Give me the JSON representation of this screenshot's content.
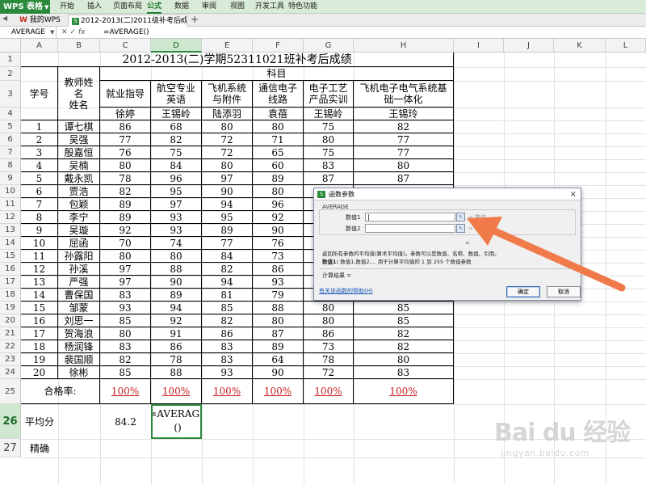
{
  "app": {
    "name": "WPS 表格"
  },
  "menu": {
    "items": [
      "开始",
      "插入",
      "页面布局",
      "公式",
      "数据",
      "审阅",
      "视图",
      "开发工具",
      "特色功能"
    ],
    "active": "公式"
  },
  "tabs": {
    "home": "我的WPS",
    "file": "2012-2013(二)2011级补考后成绩.xls *"
  },
  "formula_bar": {
    "name_box": "AVERAGE",
    "fx": "fx",
    "content": "=AVERAGE()"
  },
  "columns": [
    "A",
    "B",
    "C",
    "D",
    "E",
    "F",
    "G",
    "H",
    "I",
    "J",
    "K",
    "L"
  ],
  "active_column": "D",
  "active_row": "26",
  "sheet": {
    "title": "2012-2013(二)学期52311021班补考后成绩",
    "subject_header": "科目",
    "col_student_no": "学号",
    "col_teacher_name_1": "教师姓",
    "col_teacher_name_2": "名",
    "col_teacher_name_3": "姓名",
    "subjects": [
      {
        "l1": "就业指导",
        "l2": "",
        "teacher": "徐婷"
      },
      {
        "l1": "航空专业",
        "l2": "英语",
        "teacher": "王锡岭"
      },
      {
        "l1": "飞机系统",
        "l2": "与附件",
        "teacher": "陆添羽"
      },
      {
        "l1": "通信电子",
        "l2": "线路",
        "teacher": "袁蓓"
      },
      {
        "l1": "电子工艺",
        "l2": "产品实训",
        "teacher": "王锡岭"
      },
      {
        "l1": "飞机电子电气系统基",
        "l2": "础一体化",
        "teacher": "王锡玲"
      }
    ],
    "rows": [
      {
        "no": "1",
        "name": "谭七棋",
        "scores": [
          "86",
          "68",
          "80",
          "80",
          "75",
          "82"
        ]
      },
      {
        "no": "2",
        "name": "吴强",
        "scores": [
          "77",
          "82",
          "72",
          "71",
          "80",
          "77"
        ]
      },
      {
        "no": "3",
        "name": "殷嘉恒",
        "scores": [
          "76",
          "75",
          "72",
          "65",
          "75",
          "77"
        ]
      },
      {
        "no": "4",
        "name": "吴楠",
        "scores": [
          "80",
          "84",
          "80",
          "60",
          "83",
          "80"
        ]
      },
      {
        "no": "5",
        "name": "戴永凯",
        "scores": [
          "78",
          "96",
          "97",
          "89",
          "87",
          "87"
        ]
      },
      {
        "no": "6",
        "name": "贾浩",
        "scores": [
          "82",
          "95",
          "90",
          "80",
          "",
          ""
        ]
      },
      {
        "no": "7",
        "name": "包颖",
        "scores": [
          "89",
          "97",
          "94",
          "96",
          "",
          ""
        ]
      },
      {
        "no": "8",
        "name": "李宁",
        "scores": [
          "89",
          "93",
          "95",
          "92",
          "",
          ""
        ]
      },
      {
        "no": "9",
        "name": "吴璇",
        "scores": [
          "92",
          "93",
          "89",
          "90",
          "",
          ""
        ]
      },
      {
        "no": "10",
        "name": "屈函",
        "scores": [
          "70",
          "74",
          "77",
          "76",
          "",
          ""
        ]
      },
      {
        "no": "11",
        "name": "孙露阳",
        "scores": [
          "80",
          "80",
          "84",
          "73",
          "",
          ""
        ]
      },
      {
        "no": "12",
        "name": "孙溪",
        "scores": [
          "97",
          "88",
          "82",
          "86",
          "",
          ""
        ]
      },
      {
        "no": "13",
        "name": "严强",
        "scores": [
          "97",
          "90",
          "94",
          "93",
          "",
          ""
        ]
      },
      {
        "no": "14",
        "name": "曹保国",
        "scores": [
          "83",
          "89",
          "81",
          "79",
          "85",
          "83"
        ]
      },
      {
        "no": "15",
        "name": "邹蒙",
        "scores": [
          "93",
          "94",
          "85",
          "88",
          "80",
          "85"
        ]
      },
      {
        "no": "16",
        "name": "刘思一",
        "scores": [
          "85",
          "92",
          "82",
          "80",
          "80",
          "85"
        ]
      },
      {
        "no": "17",
        "name": "贺海浪",
        "scores": [
          "80",
          "91",
          "86",
          "87",
          "86",
          "82"
        ]
      },
      {
        "no": "18",
        "name": "杨润锋",
        "scores": [
          "83",
          "86",
          "83",
          "89",
          "73",
          "82"
        ]
      },
      {
        "no": "19",
        "name": "裴国顺",
        "scores": [
          "82",
          "78",
          "83",
          "64",
          "78",
          "80"
        ]
      },
      {
        "no": "20",
        "name": "徐彬",
        "scores": [
          "85",
          "88",
          "93",
          "90",
          "72",
          "83"
        ]
      }
    ],
    "pass_label": "合格率:",
    "pass_rates": [
      "100%",
      "100%",
      "100%",
      "100%",
      "100%",
      "100%"
    ],
    "avg_label": "平均分",
    "avg_value": "84.2",
    "avg_formula_line1": "=AVERAGE",
    "avg_formula_line2": "()",
    "precision_label": "精确"
  },
  "dialog": {
    "title": "函数参数",
    "function": "AVERAGE",
    "arg1_label": "数值1",
    "arg1_value": "|",
    "arg2_label": "数值2",
    "arg1_hint": "= 数值",
    "arg2_hint": "= 数值",
    "eq": "=",
    "desc": "返回所有参数的平均值(算术平均值)。参数可以是数值、名称、数组、引用。",
    "desc2_label": "数值1:",
    "desc2": "数值1,数值2,... 用于计算平均值的 1 到 255 个数值参数",
    "calc_label": "计算结果 =",
    "help_link": "有关该函数的帮助(H)",
    "ok": "确定",
    "cancel": "取消",
    "close": "×"
  },
  "watermark": {
    "logo": "Bai du 经验",
    "sub": "jingyan.baidu.com"
  },
  "colors": {
    "accent": "#2c8a3c",
    "arrow": "#f07a4a",
    "pass_rate": "#c81e1e"
  }
}
